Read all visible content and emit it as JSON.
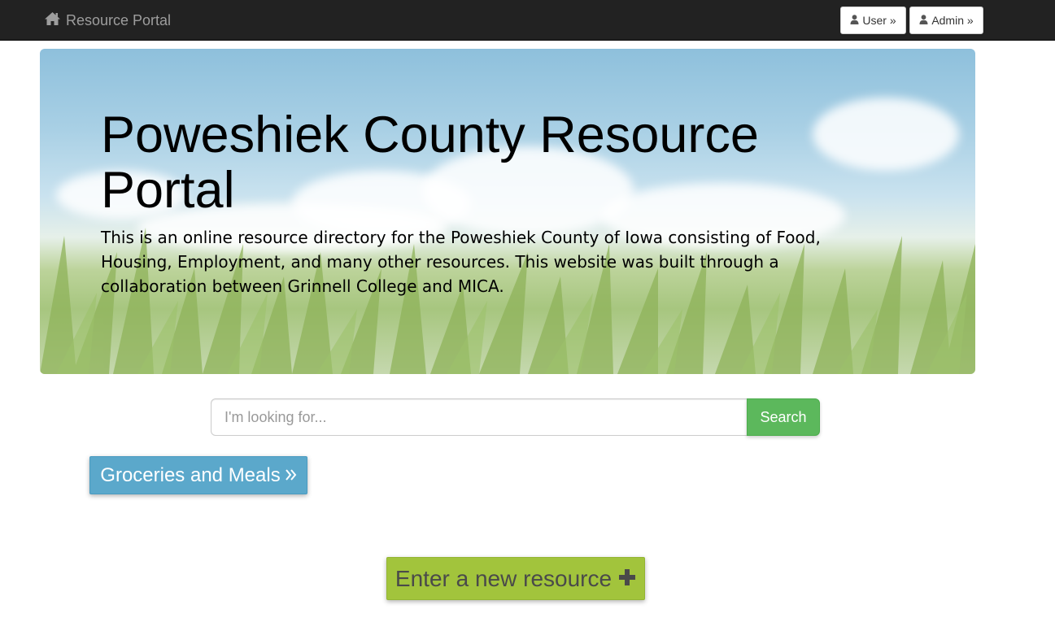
{
  "navbar": {
    "brand_label": "Resource Portal",
    "brand_icon": "home-icon",
    "user_button_label": "User »",
    "admin_button_label": "Admin »",
    "button_icon": "user-icon"
  },
  "hero": {
    "title": "Poweshiek County Resource Portal",
    "description": "This is an online resource directory for the Poweshiek County of Iowa consisting of Food, Housing, Employment, and many other resources. This website was built through a collaboration between Grinnell College and MICA."
  },
  "search": {
    "placeholder": "I'm looking for...",
    "value": "",
    "button_label": "Search"
  },
  "categories": [
    {
      "label": "Groceries and Meals",
      "icon": "double-chevron-right-icon"
    }
  ],
  "new_resource": {
    "label": "Enter a new resource",
    "icon": "plus-icon"
  },
  "colors": {
    "navbar": "#222222",
    "search_button": "#5cb85c",
    "category_button": "#5ba8cb",
    "new_resource_button": "#a2c43c"
  }
}
